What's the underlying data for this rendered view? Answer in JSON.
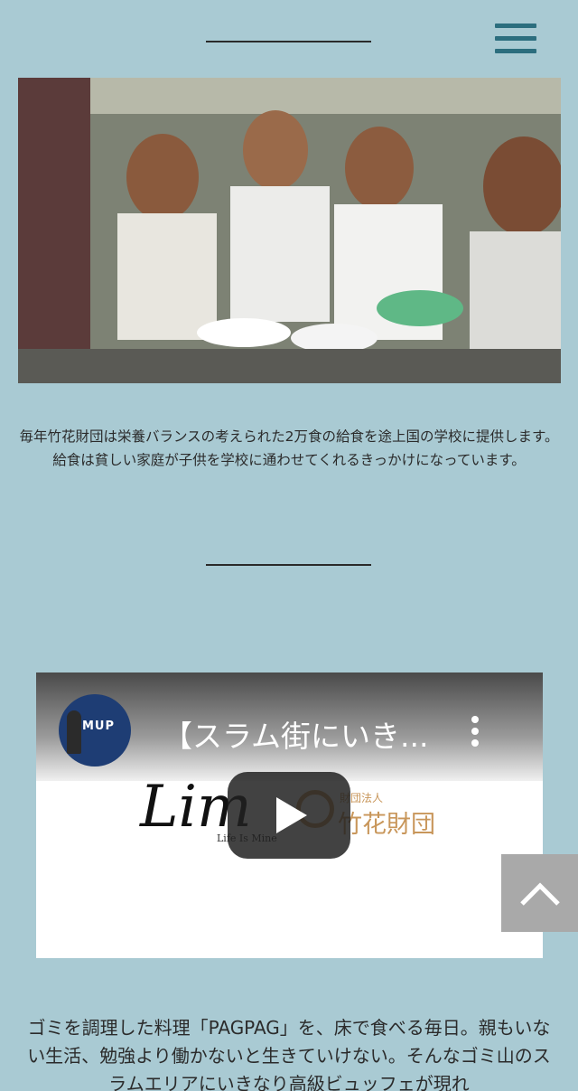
{
  "header": {
    "menu_icon": "hamburger-menu-icon"
  },
  "main": {
    "photo_alt": "",
    "caption": "毎年竹花財団は栄養バランスの考えられた2万食の給食を途上国の学校に提供します。給食は貧しい家庭が子供を学校に通わせてくれるきっかけになっています。",
    "video": {
      "channel_avatar_text": "MUP",
      "title": "【スラム街にいき...",
      "brand_script": "Lim",
      "brand_tagline": "Life Is Mine",
      "foundation_small": "財団法人",
      "foundation_name": "竹花財団",
      "play_icon": "play-icon",
      "more_icon": "more-vertical-icon"
    },
    "body_text": "ゴミを調理した料理「PAGPAG」を、床で食べる毎日。親もいない生活、勉強より働かないと生きていけない。そんなゴミ山のスラムエリアにいきなり高級ビュッフェが現れ"
  },
  "scroll_top": {
    "icon": "chevron-up-icon"
  },
  "colors": {
    "background": "#a9cad3",
    "hamburger": "#2c6e7e",
    "brand_gold": "#c8965a"
  }
}
